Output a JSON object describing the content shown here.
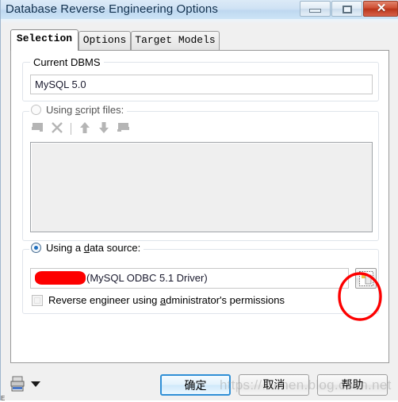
{
  "window": {
    "title": "Database Reverse Engineering Options",
    "controls": {
      "minimize": "minimize-button",
      "maximize": "maximize-button",
      "close_glyph": "✕"
    }
  },
  "tabs": [
    {
      "label": "Selection",
      "active": true
    },
    {
      "label": "Options",
      "active": false
    },
    {
      "label": "Target Models",
      "active": false
    }
  ],
  "groups": {
    "dbms": {
      "label": "Current DBMS",
      "value": "MySQL 5.0"
    },
    "script_files": {
      "label": "Using script files:",
      "label_prefix": "Using ",
      "label_accel": "s",
      "label_suffix": "cript files:",
      "selected": false,
      "toolbar": [
        {
          "name": "add-script-icon",
          "enabled": false
        },
        {
          "name": "delete-script-icon",
          "enabled": false
        },
        {
          "name": "toolbar-separator",
          "enabled": false
        },
        {
          "name": "move-up-icon",
          "enabled": false
        },
        {
          "name": "move-down-icon",
          "enabled": false
        },
        {
          "name": "script-properties-icon",
          "enabled": false
        }
      ],
      "list_items": []
    },
    "data_source": {
      "label": "Using a data source:",
      "label_prefix": "Using a ",
      "label_accel": "d",
      "label_suffix": "ata source:",
      "selected": true,
      "value_redacted": true,
      "value": "(MySQL ODBC 5.1 Driver)",
      "browse_button": "...",
      "checkbox": {
        "label": "Reverse engineer using administrator's permissions",
        "label_prefix": "Reverse engineer using ",
        "label_accel": "a",
        "label_suffix": "dministrator's permissions",
        "checked": false,
        "enabled": false
      }
    }
  },
  "footer": {
    "print_icon": "print-icon",
    "dropdown_icon": "chevron-down-icon",
    "ok_label": "确定",
    "cancel_label": "取消",
    "help_label": "帮助"
  },
  "watermark": "https://...chen.blog.csdn.net",
  "colors": {
    "titlebar": "#cfe2f4",
    "close_button": "#c74228",
    "accent_blue": "#1f6fbf",
    "annotation_red": "#fd0000",
    "dialog_bg": "#f0f0f0",
    "disabled_gray": "#b5b5b5"
  }
}
